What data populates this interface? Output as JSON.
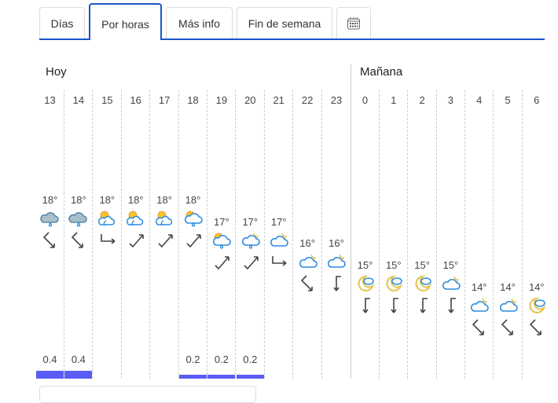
{
  "tabs": [
    {
      "label": "Días"
    },
    {
      "label": "Por horas",
      "active": true
    },
    {
      "label": "Más info"
    },
    {
      "label": "Fin de semana"
    },
    {
      "label": "",
      "icon": "calendar-icon"
    }
  ],
  "days": {
    "today": "Hoy",
    "tomorrow": "Mañana"
  },
  "accent": "#1a56c7",
  "precip_color": "#5b5cf5",
  "hours": [
    {
      "hour": "13",
      "temp": "18°",
      "t": 18,
      "icon": "rain-cloud",
      "wind": "down-right",
      "precip": "0.4",
      "p": 0.4
    },
    {
      "hour": "14",
      "temp": "18°",
      "t": 18,
      "icon": "rain-cloud",
      "wind": "down-right",
      "precip": "0.4",
      "p": 0.4
    },
    {
      "hour": "15",
      "temp": "18°",
      "t": 18,
      "icon": "sun-clouds",
      "wind": "right",
      "precip": "",
      "p": 0
    },
    {
      "hour": "16",
      "temp": "18°",
      "t": 18,
      "icon": "sun-clouds",
      "wind": "up-right",
      "precip": "",
      "p": 0
    },
    {
      "hour": "17",
      "temp": "18°",
      "t": 18,
      "icon": "sun-clouds",
      "wind": "up-right",
      "precip": "",
      "p": 0
    },
    {
      "hour": "18",
      "temp": "18°",
      "t": 18,
      "icon": "sun-cloud-drop",
      "wind": "up-right",
      "precip": "0.2",
      "p": 0.2
    },
    {
      "hour": "19",
      "temp": "17°",
      "t": 17,
      "icon": "sun-cloud-drop",
      "wind": "up-right",
      "precip": "0.2",
      "p": 0.2
    },
    {
      "hour": "20",
      "temp": "17°",
      "t": 17,
      "icon": "moon-cloud-drop",
      "wind": "up-right",
      "precip": "0.2",
      "p": 0.2
    },
    {
      "hour": "21",
      "temp": "17°",
      "t": 17,
      "icon": "moon-cloud",
      "wind": "right",
      "precip": "",
      "p": 0
    },
    {
      "hour": "22",
      "temp": "16°",
      "t": 16,
      "icon": "moon-cloud",
      "wind": "down-right",
      "precip": "",
      "p": 0
    },
    {
      "hour": "23",
      "temp": "16°",
      "t": 16,
      "icon": "moon-cloud",
      "wind": "down",
      "precip": "",
      "p": 0
    },
    {
      "hour": "0",
      "temp": "15°",
      "t": 15,
      "icon": "crescent-cloud",
      "wind": "down",
      "precip": "",
      "p": 0
    },
    {
      "hour": "1",
      "temp": "15°",
      "t": 15,
      "icon": "crescent-cloud",
      "wind": "down",
      "precip": "",
      "p": 0
    },
    {
      "hour": "2",
      "temp": "15°",
      "t": 15,
      "icon": "crescent-cloud",
      "wind": "down",
      "precip": "",
      "p": 0
    },
    {
      "hour": "3",
      "temp": "15°",
      "t": 15,
      "icon": "moon-cloud",
      "wind": "down",
      "precip": "",
      "p": 0
    },
    {
      "hour": "4",
      "temp": "14°",
      "t": 14,
      "icon": "moon-cloud",
      "wind": "down-right",
      "precip": "",
      "p": 0
    },
    {
      "hour": "5",
      "temp": "14°",
      "t": 14,
      "icon": "moon-cloud",
      "wind": "down-right",
      "precip": "",
      "p": 0
    },
    {
      "hour": "6",
      "temp": "14°",
      "t": 14,
      "icon": "crescent-cloud",
      "wind": "down-right",
      "precip": "",
      "p": 0
    }
  ]
}
